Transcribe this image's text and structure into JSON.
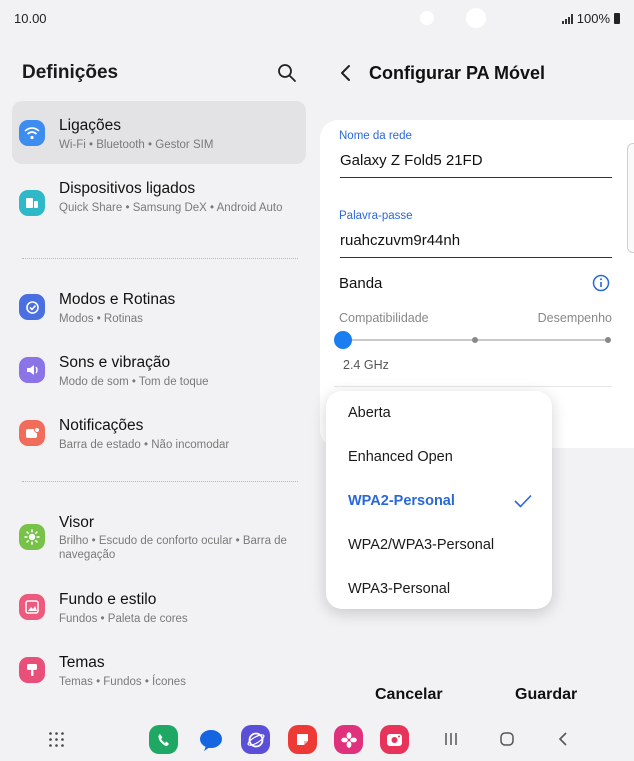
{
  "status_bar": {
    "time": "10.00",
    "battery": "100%"
  },
  "left": {
    "title": "Definições",
    "items": [
      {
        "label": "Ligações",
        "sub": "Wi-Fi  •  Bluetooth  •  Gestor SIM",
        "icon": "wifi-icon",
        "color": "#3d8cf0"
      },
      {
        "label": "Dispositivos ligados",
        "sub": "Quick Share  •  Samsung DeX  •  Android Auto",
        "icon": "devices-icon",
        "color": "#2fb8c8"
      },
      {
        "label": "Modos e Rotinas",
        "sub": "Modos  •  Rotinas",
        "icon": "modes-icon",
        "color": "#4a6fe0"
      },
      {
        "label": "Sons e vibração",
        "sub": "Modo de som  •  Tom de toque",
        "icon": "sound-icon",
        "color": "#8a74e8"
      },
      {
        "label": "Notificações",
        "sub": "Barra de estado  •  Não incomodar",
        "icon": "notification-icon",
        "color": "#f26c5b"
      },
      {
        "label": "Visor",
        "sub": "Brilho  •  Escudo de conforto ocular  •  Barra de navegação",
        "icon": "brightness-icon",
        "color": "#78c24a"
      },
      {
        "label": "Fundo e estilo",
        "sub": "Fundos  •  Paleta de cores",
        "icon": "wallpaper-icon",
        "color": "#ee5a7e"
      },
      {
        "label": "Temas",
        "sub": "Temas  •  Fundos  •  Ícones",
        "icon": "themes-icon",
        "color": "#e8507a"
      }
    ]
  },
  "right": {
    "title": "Configurar PA Móvel",
    "network_name_label": "Nome da rede",
    "network_name": "Galaxy Z Fold5 21FD",
    "password_label": "Palavra-passe",
    "password": "ruahczuvm9r44nh",
    "band_label": "Banda",
    "slider_left": "Compatibilidade",
    "slider_right": "Desempenho",
    "band_value": "2.4 GHz",
    "slider_position": 0,
    "security_options": [
      "Aberta",
      "Enhanced Open",
      "WPA2-Personal",
      "WPA2/WPA3-Personal",
      "WPA3-Personal"
    ],
    "selected_security": "WPA2-Personal",
    "cancel": "Cancelar",
    "save": "Guardar"
  },
  "nav_apps": [
    {
      "name": "phone-app-icon",
      "color": "#1fa864"
    },
    {
      "name": "messages-app-icon",
      "color": "#1565e0"
    },
    {
      "name": "internet-app-icon",
      "color": "#5b4fd8"
    },
    {
      "name": "notes-app-icon",
      "color": "#ee3a36"
    },
    {
      "name": "gallery-app-icon",
      "color": "#e0317d"
    },
    {
      "name": "camera-app-icon",
      "color": "#e8335a"
    }
  ],
  "colors": {
    "accent": "#2a68d8",
    "selected_bg": "#e3e3e6",
    "background": "#f2f2f4"
  }
}
